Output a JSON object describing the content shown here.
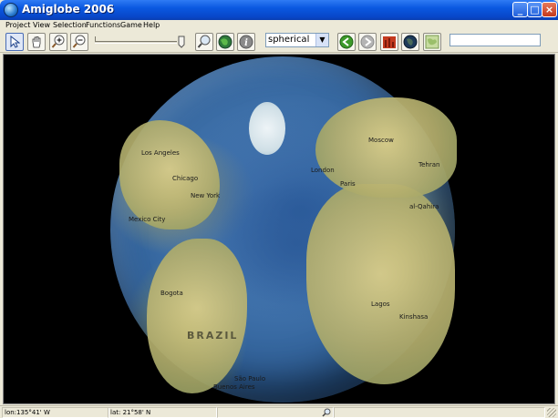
{
  "window": {
    "title": "Amiglobe 2006",
    "min_symbol": "_",
    "max_symbol": "□",
    "close_symbol": "×"
  },
  "menu": {
    "items": [
      {
        "label": "Project"
      },
      {
        "label": "View"
      },
      {
        "label": "Selection"
      },
      {
        "label": "Functions"
      },
      {
        "label": "Game"
      },
      {
        "label": "Help"
      }
    ]
  },
  "toolbar": {
    "projection_value": "spherical",
    "search_value": "",
    "icons": [
      "pointer-icon",
      "hand-icon",
      "zoom-in-icon",
      "zoom-out-icon",
      "magnifier-icon",
      "globe-icon",
      "info-icon",
      "back-icon",
      "forward-icon",
      "bar-chart-icon",
      "dark-globe-icon",
      "map-icon"
    ],
    "accent_colors": {
      "back": "#3d9a2a",
      "forward": "#9a9a9a",
      "chart": "#c43a1f"
    }
  },
  "map": {
    "cities": [
      {
        "name": "Los Angeles"
      },
      {
        "name": "Chicago"
      },
      {
        "name": "New York"
      },
      {
        "name": "Mexico City"
      },
      {
        "name": "Bogota"
      },
      {
        "name": "São Paulo"
      },
      {
        "name": "Buenos Aires"
      },
      {
        "name": "Moscow"
      },
      {
        "name": "London"
      },
      {
        "name": "Paris"
      },
      {
        "name": "Tehran"
      },
      {
        "name": "al-Qahira"
      },
      {
        "name": "Lagos"
      },
      {
        "name": "Kinshasa"
      }
    ],
    "regions": [
      {
        "name": "BRAZIL"
      }
    ]
  },
  "status": {
    "longitude": "lon:135°41' W",
    "latitude": "lat: 21°58' N"
  }
}
